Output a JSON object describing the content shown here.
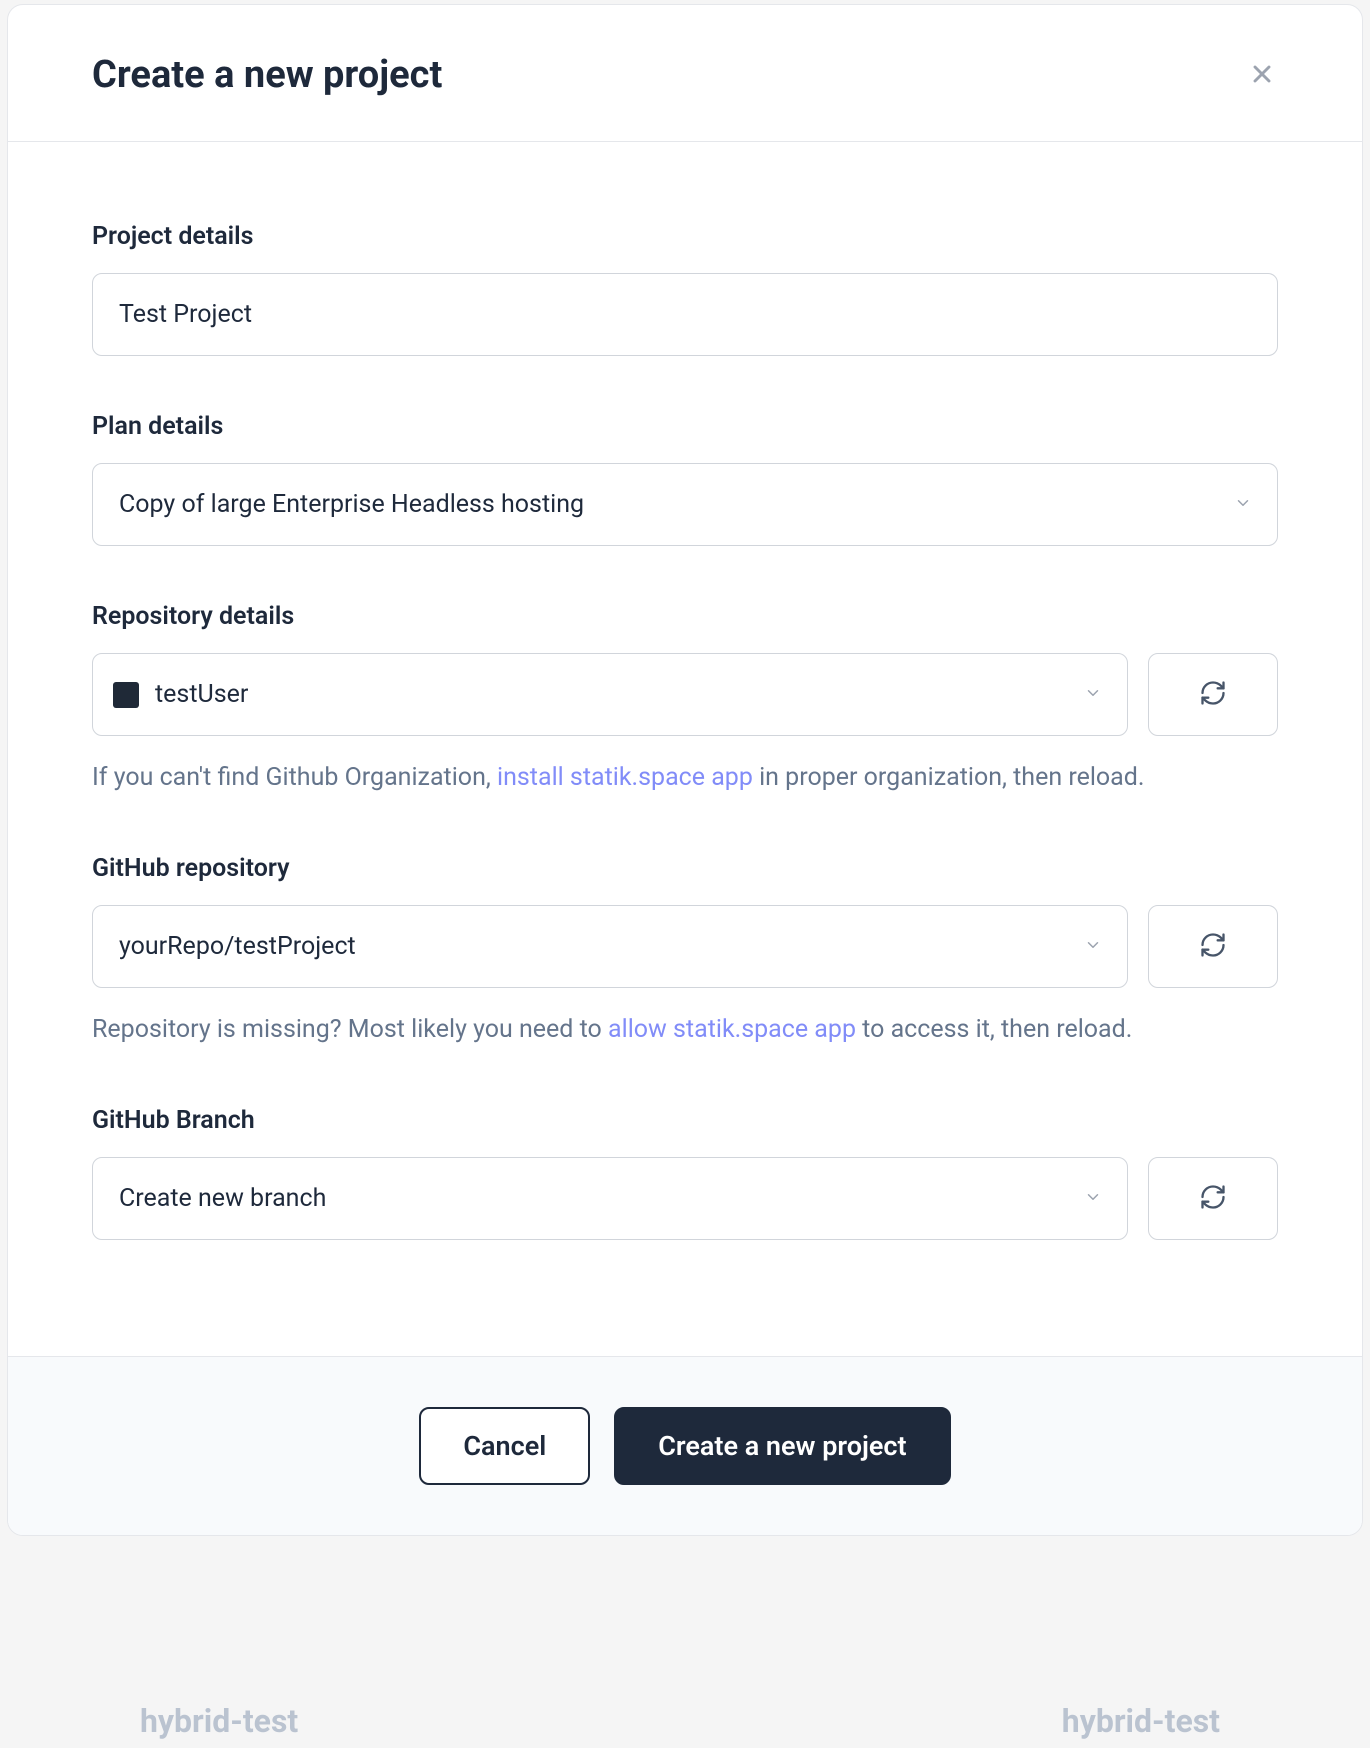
{
  "modal": {
    "title": "Create a new project"
  },
  "form": {
    "projectDetails": {
      "label": "Project details",
      "value": "Test Project"
    },
    "planDetails": {
      "label": "Plan details",
      "selected": "Copy of large Enterprise Headless hosting"
    },
    "repositoryDetails": {
      "label": "Repository details",
      "selected": "testUser",
      "helpText1": "If you can't find Github Organization, ",
      "helpLink": "install statik.space app",
      "helpText2": " in proper organization, then reload."
    },
    "githubRepository": {
      "label": "GitHub repository",
      "selected": "yourRepo/testProject",
      "helpText1": "Repository is missing? Most likely you need to ",
      "helpLink": "allow statik.space app",
      "helpText2": " to access it, then reload."
    },
    "githubBranch": {
      "label": "GitHub Branch",
      "selected": "Create new branch"
    }
  },
  "footer": {
    "cancel": "Cancel",
    "submit": "Create a new project"
  },
  "background": {
    "textLeft": "hybrid-test",
    "textRight": "hybrid-test"
  }
}
